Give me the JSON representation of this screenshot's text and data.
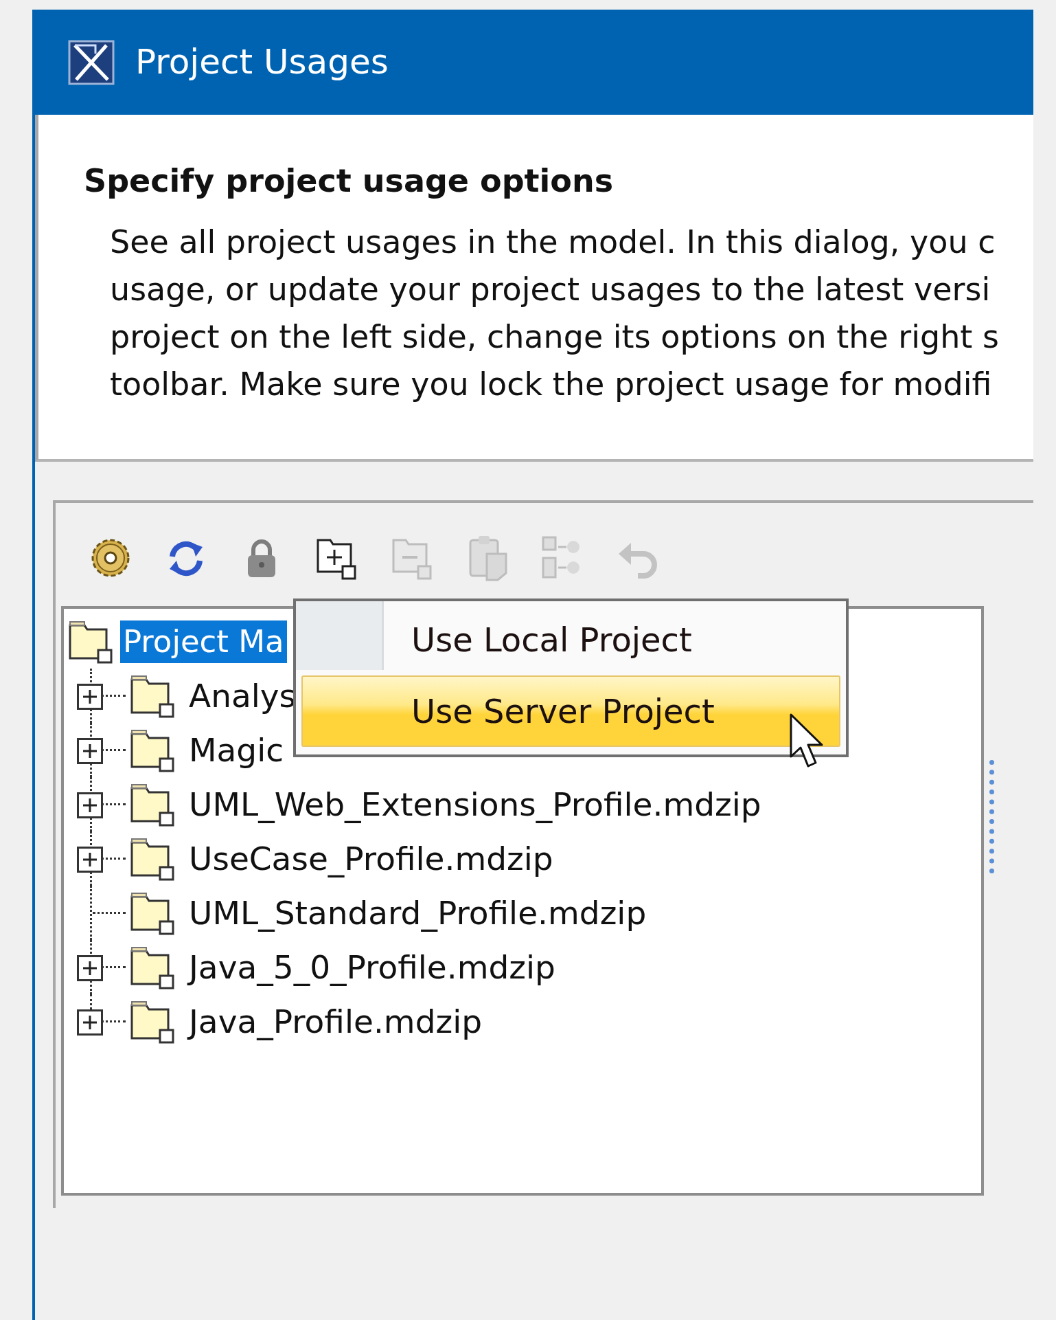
{
  "window": {
    "title": "Project Usages"
  },
  "header": {
    "heading": "Specify project usage options",
    "lines": [
      "See all project usages in the model. In this dialog, you c",
      "usage, or update your project usages to the latest versi",
      "project on the left side, change its options on the right s",
      "toolbar. Make sure you lock the project usage for modifi"
    ]
  },
  "toolbar": [
    {
      "kind": "settings",
      "disabled": false
    },
    {
      "kind": "refresh",
      "disabled": false
    },
    {
      "kind": "lock",
      "disabled": false
    },
    {
      "kind": "add",
      "disabled": false
    },
    {
      "kind": "remove",
      "disabled": true
    },
    {
      "kind": "paste",
      "disabled": true
    },
    {
      "kind": "hierarchy",
      "disabled": true
    },
    {
      "kind": "undo",
      "disabled": true
    }
  ],
  "tree": {
    "label": "Project Ma",
    "selected": true,
    "children": [
      {
        "label": "Analys",
        "kind": "branch",
        "expanded": false,
        "selected": false
      },
      {
        "label": "Magic",
        "kind": "branch",
        "expanded": false,
        "selected": false
      },
      {
        "label": "UML_Web_Extensions_Profile.mdzip",
        "kind": "branch",
        "expanded": false,
        "selected": false
      },
      {
        "label": "UseCase_Profile.mdzip",
        "kind": "branch",
        "expanded": false,
        "selected": false
      },
      {
        "label": "UML_Standard_Profile.mdzip",
        "kind": "leaf",
        "selected": false
      },
      {
        "label": "Java_5_0_Profile.mdzip",
        "kind": "branch",
        "expanded": false,
        "selected": false
      },
      {
        "label": "Java_Profile.mdzip",
        "kind": "branch",
        "expanded": false,
        "selected": false
      }
    ]
  },
  "popup_menu": {
    "items": [
      {
        "label": "Use Local Project",
        "selected": false
      },
      {
        "label": "Use Server Project",
        "selected": true
      }
    ]
  }
}
